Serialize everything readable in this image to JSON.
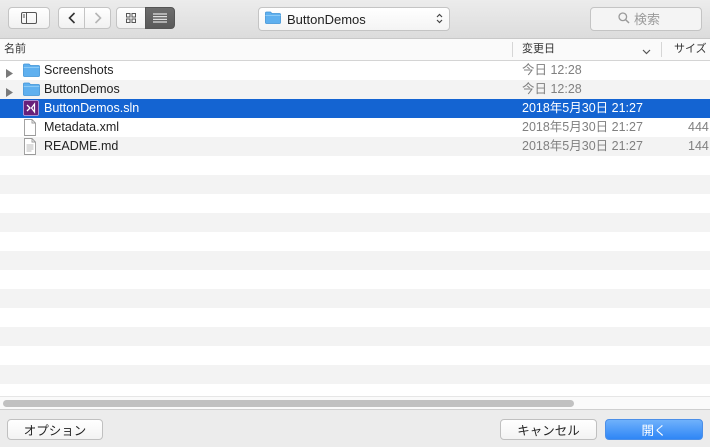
{
  "toolbar": {
    "location": {
      "label": "ButtonDemos",
      "icon": "folder-icon"
    },
    "search": {
      "placeholder": "検索"
    }
  },
  "columns": {
    "name": "名前",
    "date": "変更日",
    "size": "サイズ"
  },
  "files": [
    {
      "name": "Screenshots",
      "date": "今日 12:28",
      "size": "",
      "kind": "folder",
      "expandable": true,
      "selected": false
    },
    {
      "name": "ButtonDemos",
      "date": "今日 12:28",
      "size": "",
      "kind": "folder",
      "expandable": true,
      "selected": false
    },
    {
      "name": "ButtonDemos.sln",
      "date": "2018年5月30日 21:27",
      "size": "",
      "kind": "solution",
      "expandable": false,
      "selected": true
    },
    {
      "name": "Metadata.xml",
      "date": "2018年5月30日 21:27",
      "size": "444",
      "kind": "document",
      "expandable": false,
      "selected": false
    },
    {
      "name": "README.md",
      "date": "2018年5月30日 21:27",
      "size": "144",
      "kind": "text",
      "expandable": false,
      "selected": false
    }
  ],
  "footer": {
    "options": "オプション",
    "cancel": "キャンセル",
    "open": "開く"
  },
  "colors": {
    "selection": "#1464d2",
    "folder": "#5fb0ef",
    "accent_button": "#2f86f6",
    "solution_icon": "#68217a"
  }
}
